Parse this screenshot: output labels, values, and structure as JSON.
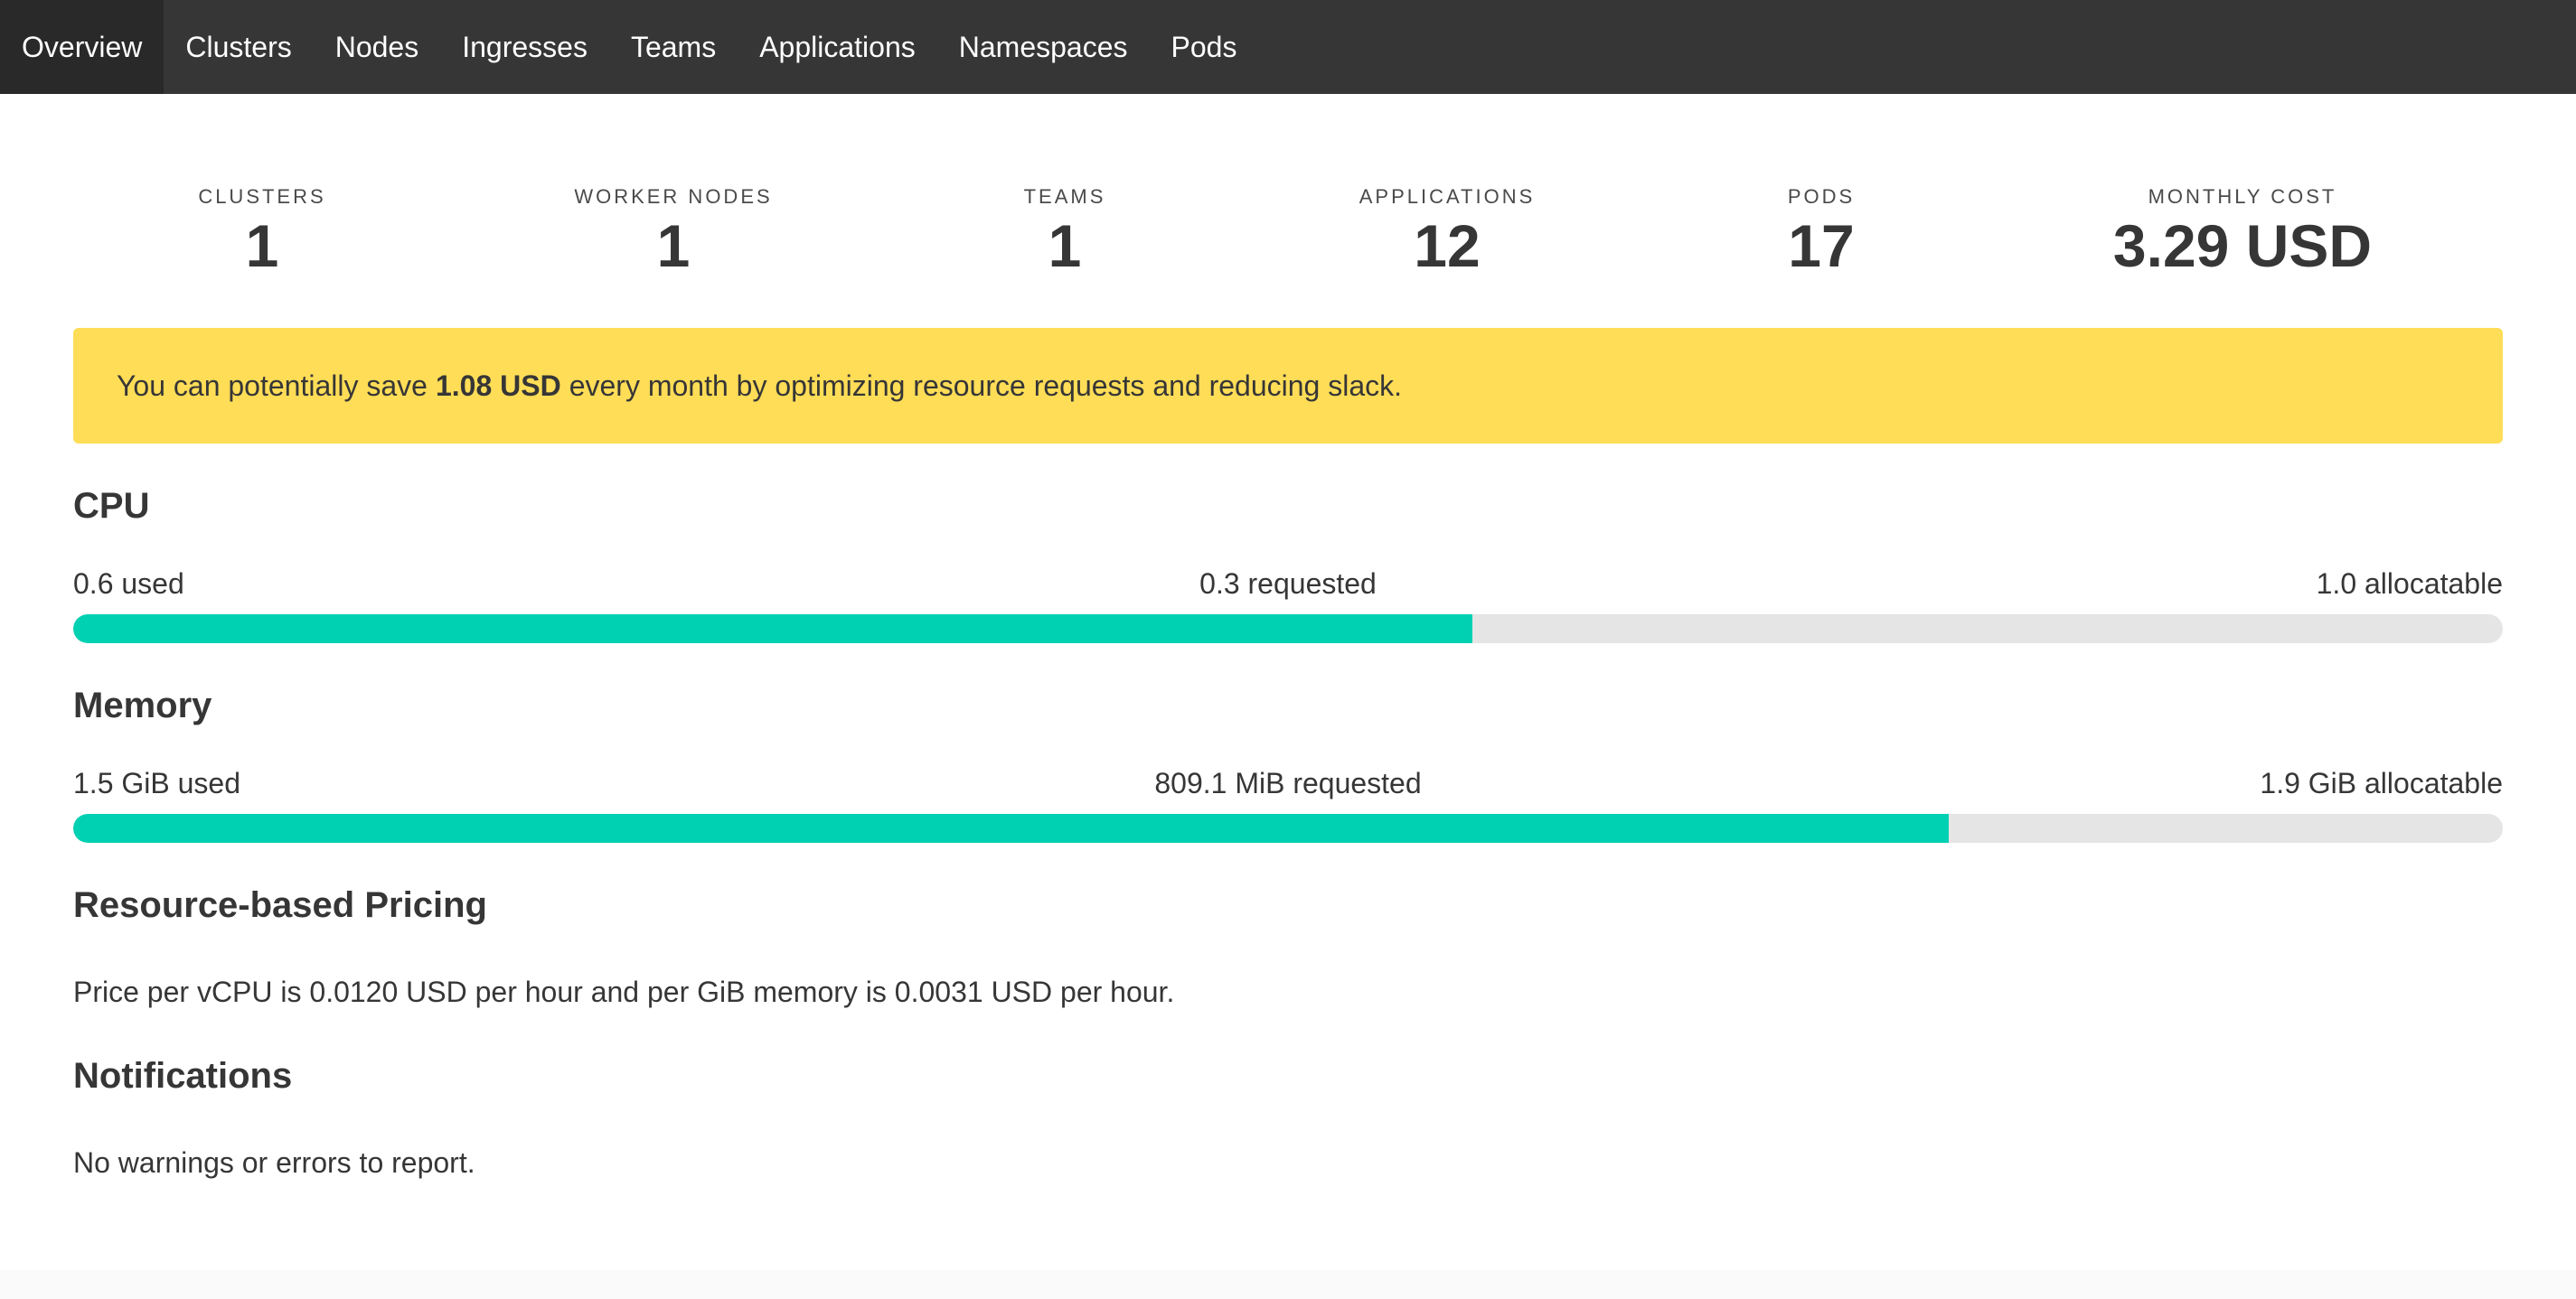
{
  "nav": {
    "items": [
      {
        "label": "Overview",
        "active": true
      },
      {
        "label": "Clusters"
      },
      {
        "label": "Nodes"
      },
      {
        "label": "Ingresses"
      },
      {
        "label": "Teams"
      },
      {
        "label": "Applications"
      },
      {
        "label": "Namespaces"
      },
      {
        "label": "Pods"
      }
    ]
  },
  "stats": [
    {
      "heading": "Clusters",
      "value": "1"
    },
    {
      "heading": "Worker Nodes",
      "value": "1"
    },
    {
      "heading": "Teams",
      "value": "1"
    },
    {
      "heading": "Applications",
      "value": "12"
    },
    {
      "heading": "Pods",
      "value": "17"
    },
    {
      "heading": "Monthly Cost",
      "value": "3.29 USD"
    }
  ],
  "savings": {
    "prefix": "You can potentially save",
    "amount": "1.08 USD",
    "suffix": "every month by optimizing resource requests and reducing slack."
  },
  "cpu": {
    "title": "CPU",
    "used_label": "0.6 used",
    "requested_label": "0.3 requested",
    "allocatable_label": "1.0 allocatable",
    "fill_fraction": 0.576
  },
  "memory": {
    "title": "Memory",
    "used_label": "1.5 GiB used",
    "requested_label": "809.1 MiB requested",
    "allocatable_label": "1.9 GiB allocatable",
    "fill_fraction": 0.772
  },
  "pricing": {
    "title": "Resource-based Pricing",
    "text": "Price per vCPU is 0.0120 USD per hour and per GiB memory is 0.0031 USD per hour."
  },
  "notifications": {
    "title": "Notifications",
    "text": "No warnings or errors to report."
  },
  "colors": {
    "navbar": "#363636",
    "active_tab": "#292929",
    "warning": "#ffdd57",
    "bar_fill": "#00d1b2",
    "bar_track": "#e5e5e5"
  }
}
